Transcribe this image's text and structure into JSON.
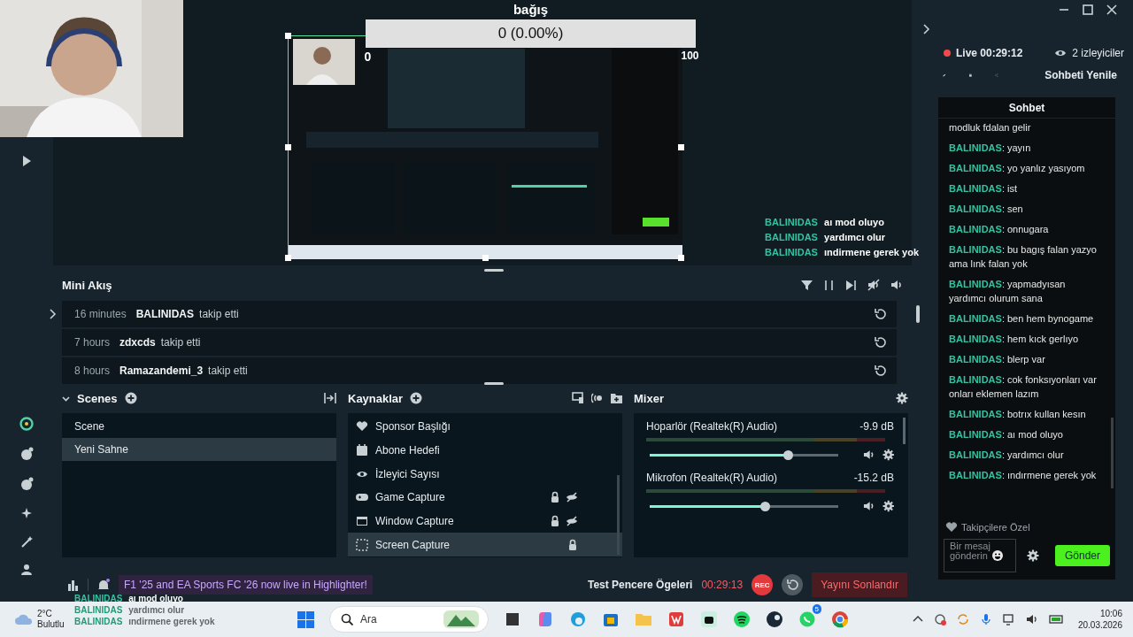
{
  "stream_overlay": {
    "goal_title": "bağış",
    "goal_amount": "0 (0.00%)",
    "goal_min": "0",
    "goal_max": "100",
    "chat_lines": [
      {
        "user": "BALINIDAS",
        "text": "aı mod oluyo"
      },
      {
        "user": "BALINIDAS",
        "text": "yardımcı olur"
      },
      {
        "user": "BALINIDAS",
        "text": "ındirmene gerek yok"
      }
    ],
    "bottom_lines": [
      {
        "user": "BALINIDAS",
        "text": "aı mod oluyo"
      },
      {
        "user": "BALINIDAS",
        "text": "yardımcı olur"
      },
      {
        "user": "BALINIDAS",
        "text": "ındirmene gerek yok"
      }
    ]
  },
  "header": {
    "live": "Live 00:29:12",
    "viewers": "2 izleyiciler",
    "refresh_chat": "Sohbeti Yenile"
  },
  "chat": {
    "title": "Sohbet",
    "messages": [
      {
        "text": "modluk fdalan gelir"
      },
      {
        "user": "BALINIDAS",
        "text": ": yayın"
      },
      {
        "user": "BALINIDAS",
        "text": ": yo yanlız yasıyom"
      },
      {
        "user": "BALINIDAS",
        "text": ": ist"
      },
      {
        "user": "BALINIDAS",
        "text": ": sen"
      },
      {
        "user": "BALINIDAS",
        "text": ": onnugara"
      },
      {
        "user": "BALINIDAS",
        "text": ": bu bagış falan yazyo ama lınk falan yok"
      },
      {
        "user": "BALINIDAS",
        "text": ": yapmadyısan yardımcı olurum sana"
      },
      {
        "user": "BALINIDAS",
        "text": ": ben hem bynogame"
      },
      {
        "user": "BALINIDAS",
        "text": ": hem kıck gerlıyo"
      },
      {
        "user": "BALINIDAS",
        "text": ": blerp var"
      },
      {
        "user": "BALINIDAS",
        "text": ": cok fonksıyonları var onları eklemen lazım"
      },
      {
        "user": "BALINIDAS",
        "text": ": botrıx kullan kesın"
      },
      {
        "user": "BALINIDAS",
        "text": ": aı mod oluyo"
      },
      {
        "user": "BALINIDAS",
        "text": ": yardımcı olur"
      },
      {
        "user": "BALINIDAS",
        "text": ": ındırmene gerek yok"
      }
    ],
    "mode": "Takipçilere Özel",
    "input": {
      "placeholder": "Bir mesaj gönderin"
    },
    "send": "Gönder"
  },
  "mini_feed": {
    "title": "Mini Akış",
    "events": [
      {
        "time": "16 minutes",
        "user": "BALINIDAS",
        "action": "takip etti"
      },
      {
        "time": "7 hours",
        "user": "zdxcds",
        "action": "takip etti"
      },
      {
        "time": "8 hours",
        "user": "Ramazandemi_3",
        "action": "takip etti"
      }
    ]
  },
  "scenes": {
    "title": "Scenes",
    "items": [
      {
        "label": "Scene",
        "selected": false
      },
      {
        "label": "Yeni Sahne",
        "selected": true
      }
    ]
  },
  "sources": {
    "title": "Kaynaklar",
    "items": [
      {
        "kind": "heart",
        "label": "Sponsor Başlığı",
        "locked": false,
        "hidden": false,
        "selected": false
      },
      {
        "kind": "calendar",
        "label": "Abone Hedefi",
        "locked": false,
        "hidden": false,
        "selected": false
      },
      {
        "kind": "eye",
        "label": "İzleyici Sayısı",
        "locked": false,
        "hidden": false,
        "selected": false
      },
      {
        "kind": "gamepad",
        "label": "Game Capture",
        "locked": true,
        "hidden": true,
        "selected": false
      },
      {
        "kind": "window",
        "label": "Window Capture",
        "locked": true,
        "hidden": true,
        "selected": false
      },
      {
        "kind": "screen",
        "label": "Screen Capture",
        "locked": true,
        "hidden": false,
        "selected": true
      }
    ]
  },
  "mixer": {
    "title": "Mixer",
    "channels": [
      {
        "name": "Hoparlör (Realtek(R) Audio)",
        "reading": "-9.9 dB",
        "level": 0.73
      },
      {
        "name": "Mikrofon (Realtek(R) Audio)",
        "reading": "-15.2 dB",
        "level": 0.61
      }
    ]
  },
  "footer": {
    "banner": "F1 '25 and EA Sports FC '26 now live in Highlighter!",
    "widget_test": "Test Pencere Ögeleri",
    "timer": "00:29:13",
    "rec": "REC",
    "end_stream": "Yayını Sonlandır"
  },
  "taskbar": {
    "temperature": "2°C",
    "weather": "Bulutlu",
    "search": {
      "placeholder": "Ara"
    },
    "whatsapp_badge": "5",
    "time": "10:06",
    "date": "20.03.2026"
  }
}
